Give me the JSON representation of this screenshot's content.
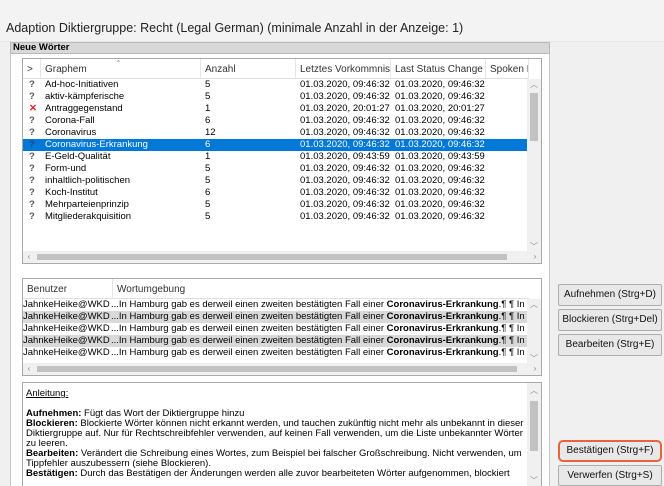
{
  "window": {
    "title": "Adaption Diktiergruppe: Recht (Legal German) (minimale Anzahl in der Anzeige: 1)"
  },
  "section": {
    "label": "Neue Wörter"
  },
  "words_table": {
    "columns": [
      ">",
      "Graphem",
      "Anzahl",
      "Letztes Vorkommnis",
      "Last Status Change",
      "Spoken F"
    ],
    "rows": [
      {
        "mark": "?",
        "graphem": "Ad-hoc-Initiativen",
        "anzahl": "5",
        "last": "01.03.2020, 09:46:32",
        "status": "01.03.2020, 09:46:32"
      },
      {
        "mark": "?",
        "graphem": "aktiv-kämpferische",
        "anzahl": "5",
        "last": "01.03.2020, 09:46:32",
        "status": "01.03.2020, 09:46:32"
      },
      {
        "mark": "✕",
        "graphem": "Antraggegenstand",
        "anzahl": "1",
        "last": "01.03.2020, 20:01:27",
        "status": "01.03.2020, 20:01:27"
      },
      {
        "mark": "?",
        "graphem": "Corona-Fall",
        "anzahl": "6",
        "last": "01.03.2020, 09:46:32",
        "status": "01.03.2020, 09:46:32"
      },
      {
        "mark": "?",
        "graphem": "Coronavirus",
        "anzahl": "12",
        "last": "01.03.2020, 09:46:32",
        "status": "01.03.2020, 09:46:32"
      },
      {
        "mark": "?",
        "graphem": "Coronavirus-Erkrankung",
        "anzahl": "6",
        "last": "01.03.2020, 09:46:32",
        "status": "01.03.2020, 09:46:32"
      },
      {
        "mark": "?",
        "graphem": "E-Geld-Qualität",
        "anzahl": "1",
        "last": "01.03.2020, 09:43:59",
        "status": "01.03.2020, 09:43:59"
      },
      {
        "mark": "?",
        "graphem": "Form-und",
        "anzahl": "5",
        "last": "01.03.2020, 09:46:32",
        "status": "01.03.2020, 09:46:32"
      },
      {
        "mark": "?",
        "graphem": "inhaltlich-politischen",
        "anzahl": "5",
        "last": "01.03.2020, 09:46:32",
        "status": "01.03.2020, 09:46:32"
      },
      {
        "mark": "?",
        "graphem": "Koch-Institut",
        "anzahl": "6",
        "last": "01.03.2020, 09:46:32",
        "status": "01.03.2020, 09:46:32"
      },
      {
        "mark": "?",
        "graphem": "Mehrparteienprinzip",
        "anzahl": "5",
        "last": "01.03.2020, 09:46:32",
        "status": "01.03.2020, 09:46:32"
      },
      {
        "mark": "?",
        "graphem": "Mitgliederakquisition",
        "anzahl": "5",
        "last": "01.03.2020, 09:46:32",
        "status": "01.03.2020, 09:46:32"
      }
    ]
  },
  "context_table": {
    "columns": [
      "Benutzer",
      "Wortumgebung"
    ],
    "rows": [
      {
        "user": "JahnkeHeike@WKD",
        "pre": "...In Hamburg gab es derweil einen zweiten bestätigten Fall einer ",
        "bold": "Coronavirus-Erkrankung",
        "post": ".¶ ¶ In B"
      },
      {
        "user": "JahnkeHeike@WKD",
        "pre": "...In Hamburg gab es derweil einen zweiten bestätigten Fall einer ",
        "bold": "Coronavirus-Erkrankung",
        "post": ".¶ ¶ In B"
      },
      {
        "user": "JahnkeHeike@WKD",
        "pre": "...In Hamburg gab es derweil einen zweiten bestätigten Fall einer ",
        "bold": "Coronavirus-Erkrankung",
        "post": ".¶ ¶ In B"
      },
      {
        "user": "JahnkeHeike@WKD",
        "pre": "...In Hamburg gab es derweil einen zweiten bestätigten Fall einer ",
        "bold": "Coronavirus-Erkrankung",
        "post": ".¶ ¶ In B"
      },
      {
        "user": "JahnkeHeike@WKD",
        "pre": "...In Hamburg gab es derweil einen zweiten bestätigten Fall einer ",
        "bold": "Coronavirus-Erkrankung",
        "post": ".¶ ¶ In B"
      }
    ]
  },
  "instructions": {
    "heading": "Anleitung:",
    "items": [
      {
        "term": "Aufnehmen:",
        "text": " Fügt das Wort der Diktiergruppe hinzu"
      },
      {
        "term": "Blockieren:",
        "text": " Blockierte Wörter können nicht erkannt werden, und tauchen zukünftig nicht mehr als unbekannt in dieser Diktiergruppe auf. Nur für Rechtschreibfehler verwenden, auf keinen Fall verwenden, um die Liste unbekannter Wörter zu leeren."
      },
      {
        "term": "Bearbeiten:",
        "text": " Verändert die Schreibung eines Wortes, zum Beispiel bei falscher Großschreibung. Nicht verwenden, um Tippfehler auszubessern (siehe Blockieren)."
      },
      {
        "term": "Bestätigen:",
        "text": " Durch das Bestätigen der Änderungen werden alle zuvor bearbeiteten Wörter aufgenommen, blockiert"
      }
    ]
  },
  "buttons": {
    "aufnehmen": "Aufnehmen (Strg+D)",
    "blockieren": "Blockieren (Strg+Del)",
    "bearbeiten": "Bearbeiten (Strg+E)",
    "bestaetigen": "Bestätigen (Strg+F)",
    "verwerfen": "Verwerfen (Strg+S)"
  },
  "selection": {
    "words_row": 5,
    "context_rows_highlighted": [
      1,
      3
    ]
  },
  "colors": {
    "selection": "#0078d7",
    "focus_outline": "#e8623a",
    "block_mark": "#e02020"
  }
}
